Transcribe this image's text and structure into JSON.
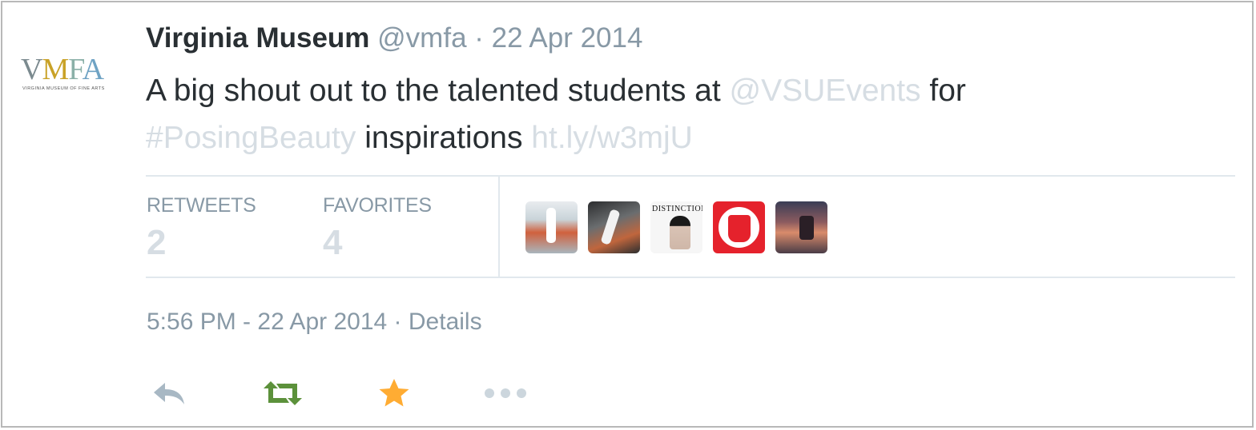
{
  "tweet": {
    "author": {
      "name": "Virginia Museum",
      "handle": "@vmfa",
      "avatar_text": "VMFA",
      "avatar_subtext": "VIRGINIA MUSEUM OF FINE ARTS"
    },
    "header_separator": "·",
    "date_short": "22 Apr 2014",
    "text": {
      "part1": "A big shout out to the talented students at ",
      "mention": "@VSUEvents",
      "part2": " for",
      "hashtag": "#PosingBeauty",
      "part3": " inspirations ",
      "link": "ht.ly/w3mjU"
    },
    "stats": {
      "retweets_label": "RETWEETS",
      "retweets_count": "2",
      "favorites_label": "FAVORITES",
      "favorites_count": "4"
    },
    "favorited_by": [
      {
        "icon": "user-photo-woman-white-dress"
      },
      {
        "icon": "user-photo-dancer"
      },
      {
        "icon": "user-magazine-cover",
        "text": "DISTINCTION"
      },
      {
        "icon": "user-red-logo"
      },
      {
        "icon": "user-deer-illustration"
      }
    ],
    "timestamp": "5:56 PM - 22 Apr 2014",
    "footer_separator": "·",
    "details_label": "Details",
    "actions": {
      "reply": {
        "icon": "reply-icon",
        "color": "#a8b8c4"
      },
      "retweet": {
        "icon": "retweet-icon",
        "color": "#5c913b"
      },
      "favorite": {
        "icon": "star-icon",
        "color": "#ffac33"
      },
      "more": {
        "icon": "more-icon",
        "color": "#ccd6dd"
      }
    },
    "colors": {
      "text": "#292f33",
      "muted": "#8899a6",
      "faint_link": "#d6dde3",
      "border": "#e1e8ed"
    }
  }
}
